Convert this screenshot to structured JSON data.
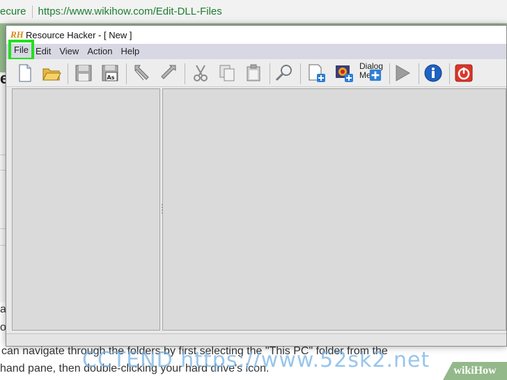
{
  "browser": {
    "url_secure": "ecure",
    "url": "https://www.wikihow.com/Edit-DLL-Files"
  },
  "background_page": {
    "heading_letter": "e",
    "side_fragment_1": "at",
    "side_fragment_2": "ou",
    "body_line_1": "can navigate through the folders by first selecting the \"This PC\" folder from the",
    "body_line_2": "hand pane, then double-clicking your hard drive's icon.",
    "watermark": "CCTEND https://www.52sk2.net",
    "logo": "wikiHow"
  },
  "window": {
    "icon_text": "RH",
    "title": "Resource Hacker - [ New ]"
  },
  "menu": {
    "file": "File",
    "edit": "Edit",
    "view": "View",
    "action": "Action",
    "help": "Help"
  },
  "toolbar": {
    "dialog_label_1": "Dialog",
    "dialog_label_2": "Me"
  },
  "colors": {
    "highlight": "#22e01e",
    "menubar": "#d8d8e4",
    "pane": "#dadada",
    "run_red": "#d9372a",
    "info_blue": "#1e62c2"
  }
}
